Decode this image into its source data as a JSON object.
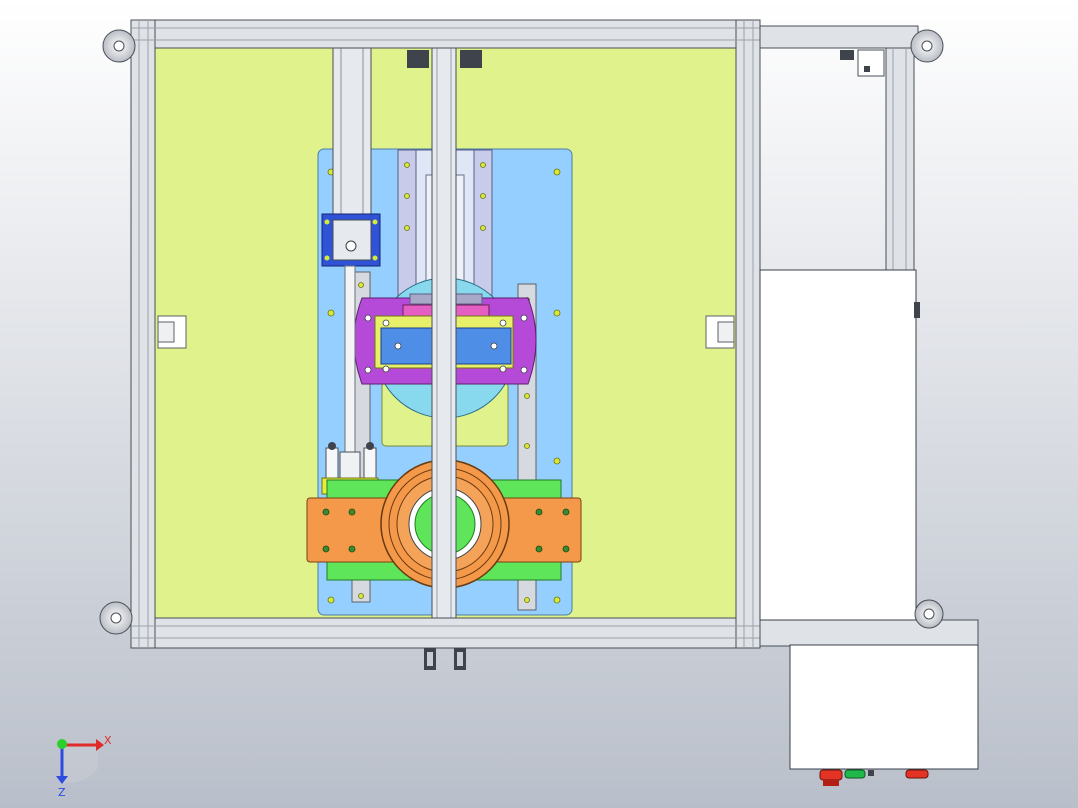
{
  "viewport": {
    "background_top": "#ffffff",
    "background_bottom": "#b9bfca"
  },
  "colors": {
    "frame_profile": "#dfe3e8",
    "frame_edge": "#4a4f57",
    "base_plate": "#e0f28c",
    "mount_plate": "#95cfff",
    "rotary_disc": "#89d9ee",
    "clamp_arm": "#b64ad8",
    "slider_block": "#4f8ee6",
    "cylinder_mount": "#2f52d6",
    "green_rail": "#5ee55a",
    "orange_bracket": "#f49849",
    "cabinet": "#ffffff",
    "button_red": "#e23324",
    "button_green": "#1fb84a"
  },
  "triad": {
    "x_label": "X",
    "z_label": "Z"
  },
  "icons": {
    "triad": "coordinate-triad-icon",
    "pneumatic_cylinder": "pneumatic-cylinder-icon",
    "rotary_table": "rotary-table-icon",
    "control_buttons": "push-button-icon"
  }
}
